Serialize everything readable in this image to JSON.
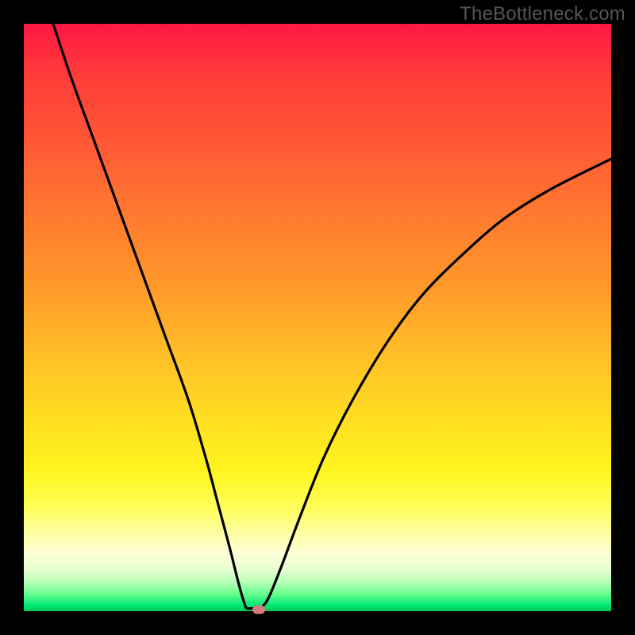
{
  "watermark": "TheBottleneck.com",
  "chart_data": {
    "type": "line",
    "title": "",
    "xlabel": "",
    "ylabel": "",
    "xlim": [
      0,
      100
    ],
    "ylim": [
      0,
      100
    ],
    "gradient_note": "Vertical gradient background: red (100%) → orange → yellow → pale yellow → green (0%)",
    "series": [
      {
        "name": "curve",
        "x": [
          5,
          8,
          12,
          16,
          20,
          24,
          28,
          31,
          33,
          35,
          36.5,
          37.5,
          38,
          39,
          40,
          41,
          42,
          44,
          47,
          51,
          56,
          62,
          68,
          75,
          82,
          90,
          100
        ],
        "y": [
          100,
          91,
          80,
          69,
          58,
          47,
          36,
          26,
          18.5,
          11,
          5,
          1.5,
          0.5,
          0.5,
          0.5,
          1.2,
          3,
          8,
          16,
          26,
          36,
          46,
          54,
          61,
          67,
          72,
          77
        ]
      }
    ],
    "marker": {
      "x": 40,
      "y": 0.3,
      "color": "#d47a7a"
    }
  },
  "colors": {
    "background": "#000000",
    "curve": "#000000",
    "marker": "#d47a7a",
    "watermark": "#555555"
  }
}
